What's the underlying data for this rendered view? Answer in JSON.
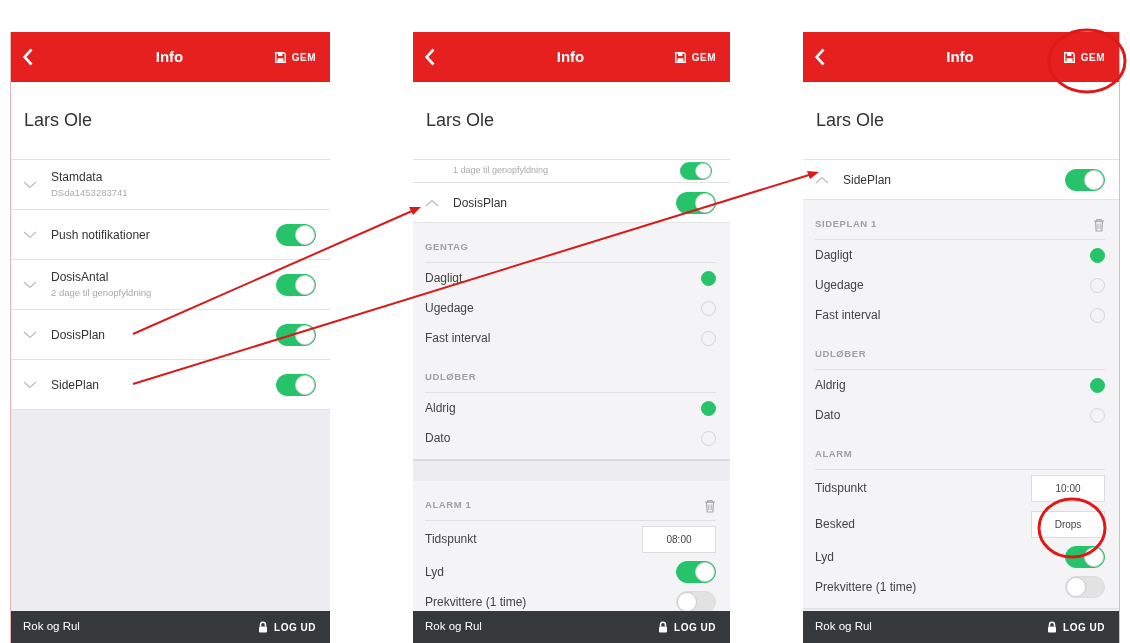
{
  "screens": [
    {
      "header": {
        "title": "Info",
        "save_label": "GEM"
      },
      "name": "Lars Ole",
      "items": [
        {
          "kind": "accordion",
          "title": "Stamdata",
          "subtitle": "DSda1453283741",
          "expanded": false
        },
        {
          "kind": "accordion",
          "title": "Push notifikationer",
          "expanded": false,
          "on": true
        },
        {
          "kind": "accordion",
          "title": "DosisAntal",
          "subtitle": "2 dage til genopfyldning",
          "expanded": false,
          "on": true
        },
        {
          "kind": "accordion",
          "title": "DosisPlan",
          "expanded": false,
          "on": true
        },
        {
          "kind": "accordion",
          "title": "SidePlan",
          "expanded": false,
          "on": true
        }
      ],
      "footer": {
        "brand": "Rok og Rul",
        "logout": "LOG UD"
      }
    },
    {
      "header": {
        "title": "Info",
        "save_label": "GEM"
      },
      "name": "Lars Ole",
      "items": [
        {
          "kind": "cut_row",
          "subtitle": "1 dage til genopfyldning",
          "on": true
        },
        {
          "kind": "accordion",
          "title": "DosisPlan",
          "expanded": true,
          "on": true,
          "children": [
            {
              "kind": "heading",
              "label": "GENTAG",
              "deletable": false
            },
            {
              "kind": "radio",
              "label": "Dagligt",
              "selected": true
            },
            {
              "kind": "radio",
              "label": "Ugedage",
              "selected": false
            },
            {
              "kind": "radio",
              "label": "Fast interval",
              "selected": false
            },
            {
              "kind": "heading",
              "label": "UDLØBER",
              "deletable": false
            },
            {
              "kind": "radio",
              "label": "Aldrig",
              "selected": true
            },
            {
              "kind": "radio",
              "label": "Dato",
              "selected": false
            },
            {
              "kind": "break"
            },
            {
              "kind": "heading",
              "label": "ALARM 1",
              "deletable": true
            },
            {
              "kind": "field",
              "label": "Tidspunkt",
              "value": "08:00"
            },
            {
              "kind": "switch",
              "label": "Lyd",
              "on": true
            },
            {
              "kind": "switch",
              "label": "Prekvittere (1 time)",
              "on": false
            }
          ]
        }
      ],
      "footer": {
        "brand": "Rok og Rul",
        "logout": "LOG UD"
      }
    },
    {
      "header": {
        "title": "Info",
        "save_label": "GEM"
      },
      "name": "Lars Ole",
      "items": [
        {
          "kind": "accordion",
          "title": "SidePlan",
          "expanded": true,
          "on": true,
          "children": [
            {
              "kind": "heading",
              "label": "SIDEPLAN 1",
              "deletable": true
            },
            {
              "kind": "radio",
              "label": "Dagligt",
              "selected": true
            },
            {
              "kind": "radio",
              "label": "Ugedage",
              "selected": false
            },
            {
              "kind": "radio",
              "label": "Fast interval",
              "selected": false
            },
            {
              "kind": "heading",
              "label": "UDLØBER",
              "deletable": false
            },
            {
              "kind": "radio",
              "label": "Aldrig",
              "selected": true
            },
            {
              "kind": "radio",
              "label": "Dato",
              "selected": false
            },
            {
              "kind": "heading",
              "label": "ALARM",
              "deletable": false
            },
            {
              "kind": "field",
              "label": "Tidspunkt",
              "value": "10:00"
            },
            {
              "kind": "field",
              "label": "Besked",
              "value": "Drops"
            },
            {
              "kind": "switch",
              "label": "Lyd",
              "on": true
            },
            {
              "kind": "switch",
              "label": "Prekvittere (1 time)",
              "on": false
            }
          ]
        }
      ],
      "footer": {
        "brand": "Rok og Rul",
        "logout": "LOG UD"
      }
    }
  ]
}
